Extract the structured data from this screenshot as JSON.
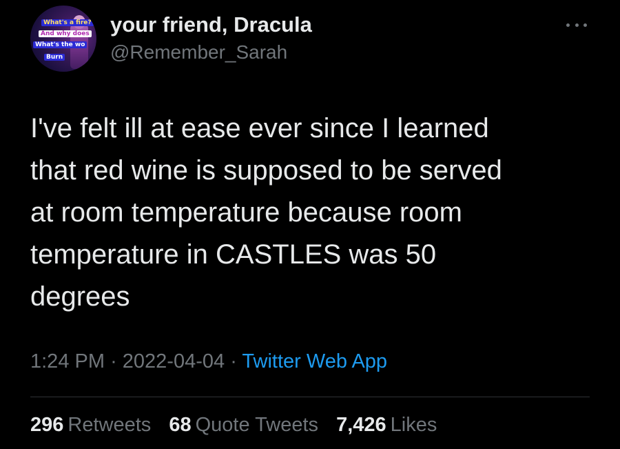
{
  "tweet": {
    "display_name": "your friend, Dracula",
    "handle": "@Remember_Sarah",
    "text": "I've felt ill at ease ever since I learned\nthat red wine is supposed to be served\nat room temperature because room\ntemperature in CASTLES was 50\ndegrees",
    "time": "1:24 PM",
    "separator": "·",
    "date": "2022-04-04",
    "source": "Twitter Web App"
  },
  "avatar": {
    "caption_lines": [
      "What's a fire?",
      "And why does",
      "What's the wo",
      "Burn"
    ]
  },
  "more_icon": "ellipsis-horizontal-icon",
  "stats": [
    {
      "count": "296",
      "label": "Retweets"
    },
    {
      "count": "68",
      "label": "Quote Tweets"
    },
    {
      "count": "7,426",
      "label": "Likes"
    }
  ],
  "colors": {
    "background": "#000000",
    "primary_text": "#e7e9ea",
    "secondary_text": "#71767b",
    "accent": "#1d9bf0",
    "divider": "#2f3336"
  }
}
